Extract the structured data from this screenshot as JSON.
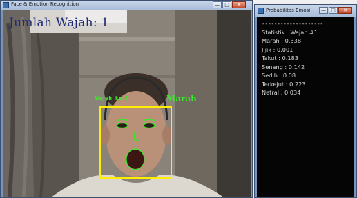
{
  "main_window": {
    "title": "Face & Emotion Recognition",
    "buttons": {
      "minimize": "—",
      "maximize": "□",
      "close": "✕"
    }
  },
  "overlay": {
    "face_count": "Jumlah Wajah: 1",
    "face_label": "Wajah ke-1",
    "emotion": "Marah",
    "box_color": "#ffee00",
    "text_color": "#33ee22"
  },
  "probability_window": {
    "title": "Probabilitas Emosi",
    "buttons": {
      "minimize": "—",
      "maximize": "□",
      "close": "✕"
    },
    "separator": "--------------------",
    "lines": [
      "Statistik : Wajah #1",
      "Marah : 0.338",
      "Jijik : 0.001",
      "Takut : 0.183",
      "Senang : 0.142",
      "Sedih : 0.08",
      "Terkejut : 0.223",
      "Netral : 0.034"
    ]
  }
}
